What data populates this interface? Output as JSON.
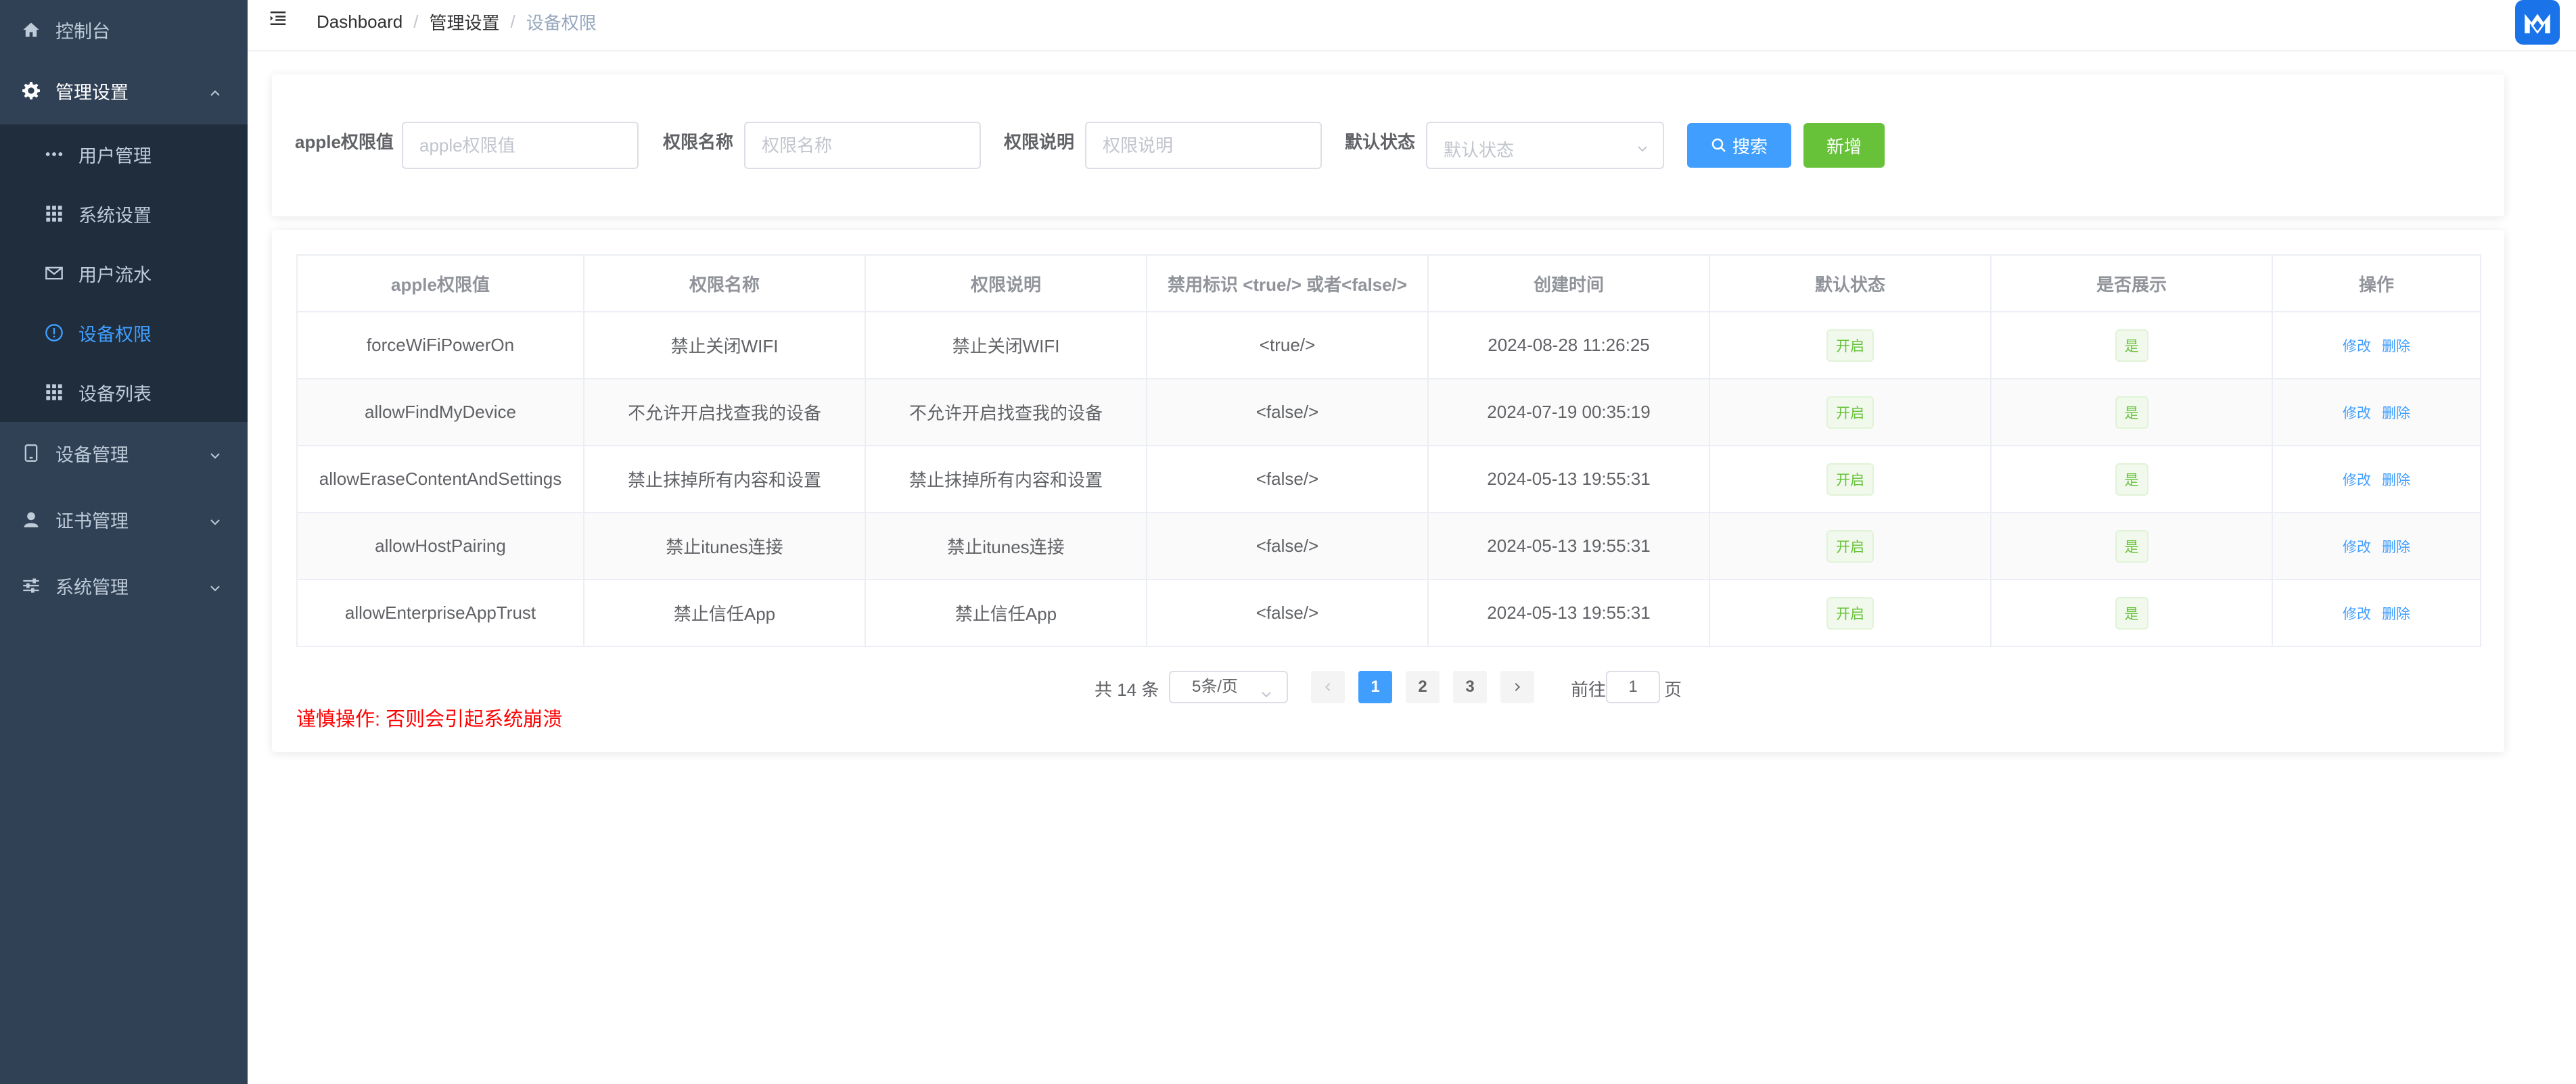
{
  "sidebar": {
    "items": [
      {
        "label": "控制台",
        "icon": "home-icon"
      },
      {
        "label": "管理设置",
        "icon": "gear-icon",
        "expanded": true
      },
      {
        "label": "用户管理",
        "icon": "dots-icon"
      },
      {
        "label": "系统设置",
        "icon": "grid-icon"
      },
      {
        "label": "用户流水",
        "icon": "mail-icon"
      },
      {
        "label": "设备权限",
        "icon": "info-icon",
        "active": true
      },
      {
        "label": "设备列表",
        "icon": "grid-icon"
      },
      {
        "label": "设备管理",
        "icon": "tablet-icon"
      },
      {
        "label": "证书管理",
        "icon": "user-icon"
      },
      {
        "label": "系统管理",
        "icon": "sliders-icon"
      }
    ]
  },
  "header": {
    "breadcrumb": [
      "Dashboard",
      "管理设置",
      "设备权限"
    ],
    "separator": "/"
  },
  "search": {
    "fields": [
      {
        "label": "apple权限值",
        "placeholder": "apple权限值"
      },
      {
        "label": "权限名称",
        "placeholder": "权限名称"
      },
      {
        "label": "权限说明",
        "placeholder": "权限说明"
      },
      {
        "label": "默认状态",
        "placeholder": "默认状态"
      }
    ],
    "search_button": "搜索",
    "add_button": "新增"
  },
  "table": {
    "columns": [
      "apple权限值",
      "权限名称",
      "权限说明",
      "禁用标识 <true/> 或者<false/>",
      "创建时间",
      "默认状态",
      "是否展示",
      "操作"
    ],
    "rows": [
      {
        "key": "forceWiFiPowerOn",
        "name": "禁止关闭WIFI",
        "desc": "禁止关闭WIFI",
        "flag": "<true/>",
        "created": "2024-08-28 11:26:25",
        "status": "开启",
        "show": "是"
      },
      {
        "key": "allowFindMyDevice",
        "name": "不允许开启找查我的设备",
        "desc": "不允许开启找查我的设备",
        "flag": "<false/>",
        "created": "2024-07-19 00:35:19",
        "status": "开启",
        "show": "是"
      },
      {
        "key": "allowEraseContentAndSettings",
        "name": "禁止抹掉所有内容和设置",
        "desc": "禁止抹掉所有内容和设置",
        "flag": "<false/>",
        "created": "2024-05-13 19:55:31",
        "status": "开启",
        "show": "是"
      },
      {
        "key": "allowHostPairing",
        "name": "禁止itunes连接",
        "desc": "禁止itunes连接",
        "flag": "<false/>",
        "created": "2024-05-13 19:55:31",
        "status": "开启",
        "show": "是"
      },
      {
        "key": "allowEnterpriseAppTrust",
        "name": "禁止信任App",
        "desc": "禁止信任App",
        "flag": "<false/>",
        "created": "2024-05-13 19:55:31",
        "status": "开启",
        "show": "是"
      }
    ],
    "edit_label": "修改",
    "delete_label": "删除"
  },
  "pagination": {
    "total": "共 14 条",
    "page_size": "5条/页",
    "pages": [
      "1",
      "2",
      "3"
    ],
    "current": "1",
    "goto_label": "前往",
    "goto_value": "1",
    "page_suffix": "页"
  },
  "warning": "谨慎操作:  否则会引起系统崩溃",
  "colors": {
    "sidebar_bg": "#304156",
    "submenu_bg": "#1f2d3d",
    "primary": "#409eff",
    "success": "#67c23a",
    "danger": "#ff0000"
  }
}
